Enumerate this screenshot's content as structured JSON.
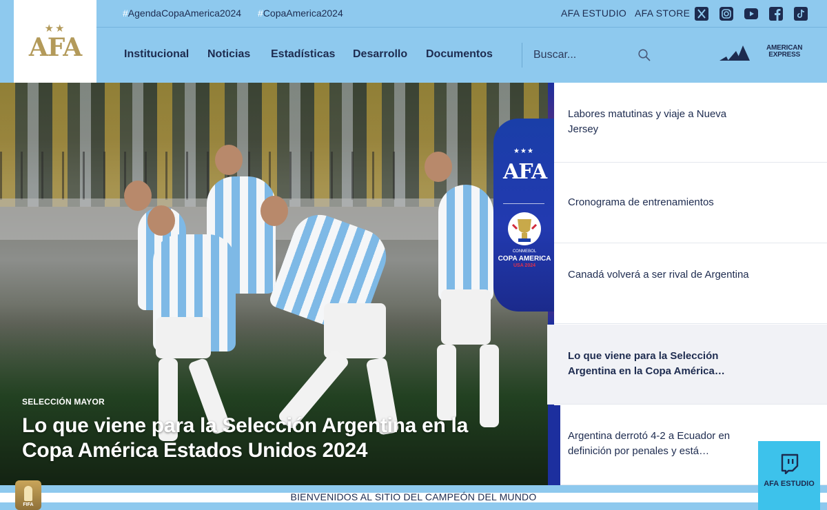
{
  "logo": {
    "stars": "★★",
    "text": "AFA"
  },
  "topbar": {
    "hashtags": [
      {
        "hash": "#",
        "label": "AgendaCopaAmerica2024"
      },
      {
        "hash": "#",
        "label": "CopaAmerica2024"
      }
    ],
    "links": [
      "AFA ESTUDIO",
      "AFA STORE"
    ],
    "social_icons": [
      "x-icon",
      "instagram-icon",
      "youtube-icon",
      "facebook-icon",
      "tiktok-icon"
    ]
  },
  "nav": {
    "items": [
      "Institucional",
      "Noticias",
      "Estadísticas",
      "Desarrollo",
      "Documentos"
    ]
  },
  "search": {
    "placeholder": "Buscar..."
  },
  "sponsors": {
    "amex_line1": "AMERICAN",
    "amex_line2": "EXPRESS"
  },
  "hero": {
    "category": "SELECCIÓN MAYOR",
    "title": "Lo que viene para la Selección Argentina en la Copa América Estados Unidos 2024",
    "badge": {
      "afa_stars": "★★★",
      "afa_text": "AFA",
      "conmebol": "CONMEBOL",
      "title": "COPA AMERICA",
      "subtitle": "USA 2024"
    }
  },
  "news": [
    {
      "text": "Labores matutinas y viaje a Nueva Jersey",
      "active": false
    },
    {
      "text": "Cronograma de entrenamientos",
      "active": false
    },
    {
      "text": "Canadá volverá a ser rival de Argentina",
      "active": false
    },
    {
      "text": "Lo que viene para la Selección Argentina en la Copa América…",
      "active": true
    },
    {
      "text": "Argentina derrotó 4-2 a Ecuador en definición por penales y está…",
      "active": false
    }
  ],
  "footer": {
    "text": "BIENVENIDOS AL SITIO DEL CAMPEÓN DEL MUNDO",
    "fifa_badge_text": "FIFA"
  },
  "studio_button": {
    "label": "AFA ESTUDIO"
  },
  "colors": {
    "header": "#8ec9ee",
    "navy": "#1d2b4f",
    "gold": "#b39a5a",
    "studio": "#3dc2eb"
  }
}
